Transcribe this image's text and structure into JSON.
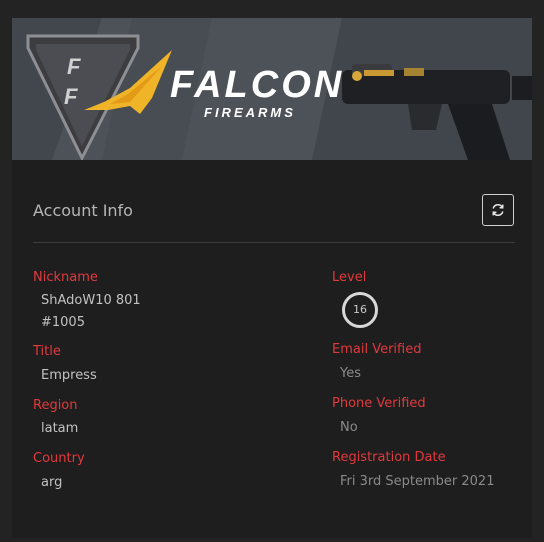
{
  "banner": {
    "brand_name": "FALCON",
    "brand_sub": "FIREARMS",
    "emblem_letter": "F"
  },
  "account": {
    "title": "Account Info",
    "refresh_icon": "refresh-icon"
  },
  "fields": {
    "nickname": {
      "label": "Nickname",
      "value_line1": "ShAdoW10 801",
      "value_line2": "#1005"
    },
    "title": {
      "label": "Title",
      "value": "Empress"
    },
    "region": {
      "label": "Region",
      "value": "latam"
    },
    "country": {
      "label": "Country",
      "value": "arg"
    },
    "level": {
      "label": "Level",
      "value": "16"
    },
    "email_verified": {
      "label": "Email Verified",
      "value": "Yes"
    },
    "phone_verified": {
      "label": "Phone Verified",
      "value": "No"
    },
    "registration_date": {
      "label": "Registration Date",
      "value": "Fri 3rd September 2021"
    }
  },
  "colors": {
    "accent_red": "#e0393e",
    "background": "#1f1e1e",
    "banner_gold": "#f0b428"
  }
}
